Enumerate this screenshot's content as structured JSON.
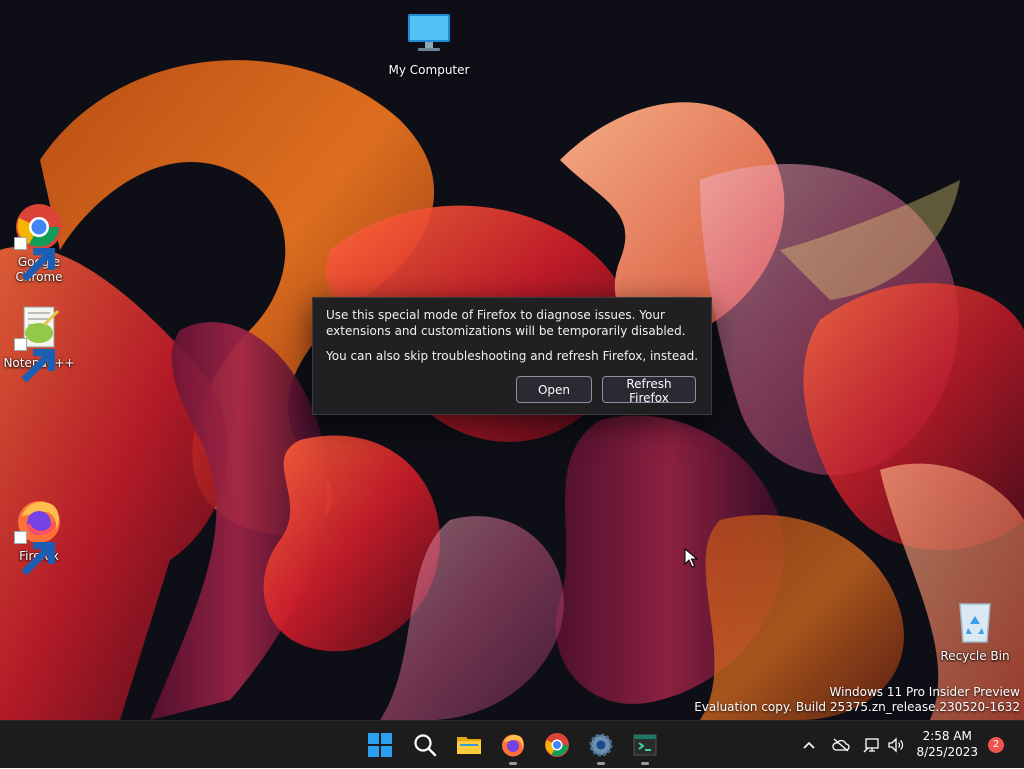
{
  "desktop": {
    "icons": {
      "my_computer": "My Computer",
      "chrome": "Google Chrome",
      "notepad": "Notepad++",
      "firefox": "Firefox",
      "recycle_bin": "Recycle Bin"
    },
    "watermark": {
      "line1": "Windows 11 Pro Insider Preview",
      "line2": "Evaluation copy. Build 25375.zn_release.230520-1632"
    }
  },
  "dialog": {
    "message1": "Use this special mode of Firefox to diagnose issues. Your extensions and customizations will be temporarily disabled.",
    "message2": "You can also skip troubleshooting and refresh Firefox, instead.",
    "open_label": "Open",
    "refresh_label": "Refresh Firefox"
  },
  "taskbar": {
    "icons": [
      "windows-start-icon",
      "search-icon",
      "file-explorer-icon",
      "firefox-icon",
      "chrome-icon",
      "settings-icon",
      "terminal-icon"
    ],
    "clock": {
      "time": "2:58 AM",
      "date": "8/25/2023"
    },
    "notification_count": "2"
  },
  "colors": {
    "taskbar_bg": "#1c1c1c",
    "dialog_bg": "#202023",
    "button_border": "#8f8f9d",
    "badge": "#f0544f",
    "start_blue": "#2aa0f0"
  }
}
